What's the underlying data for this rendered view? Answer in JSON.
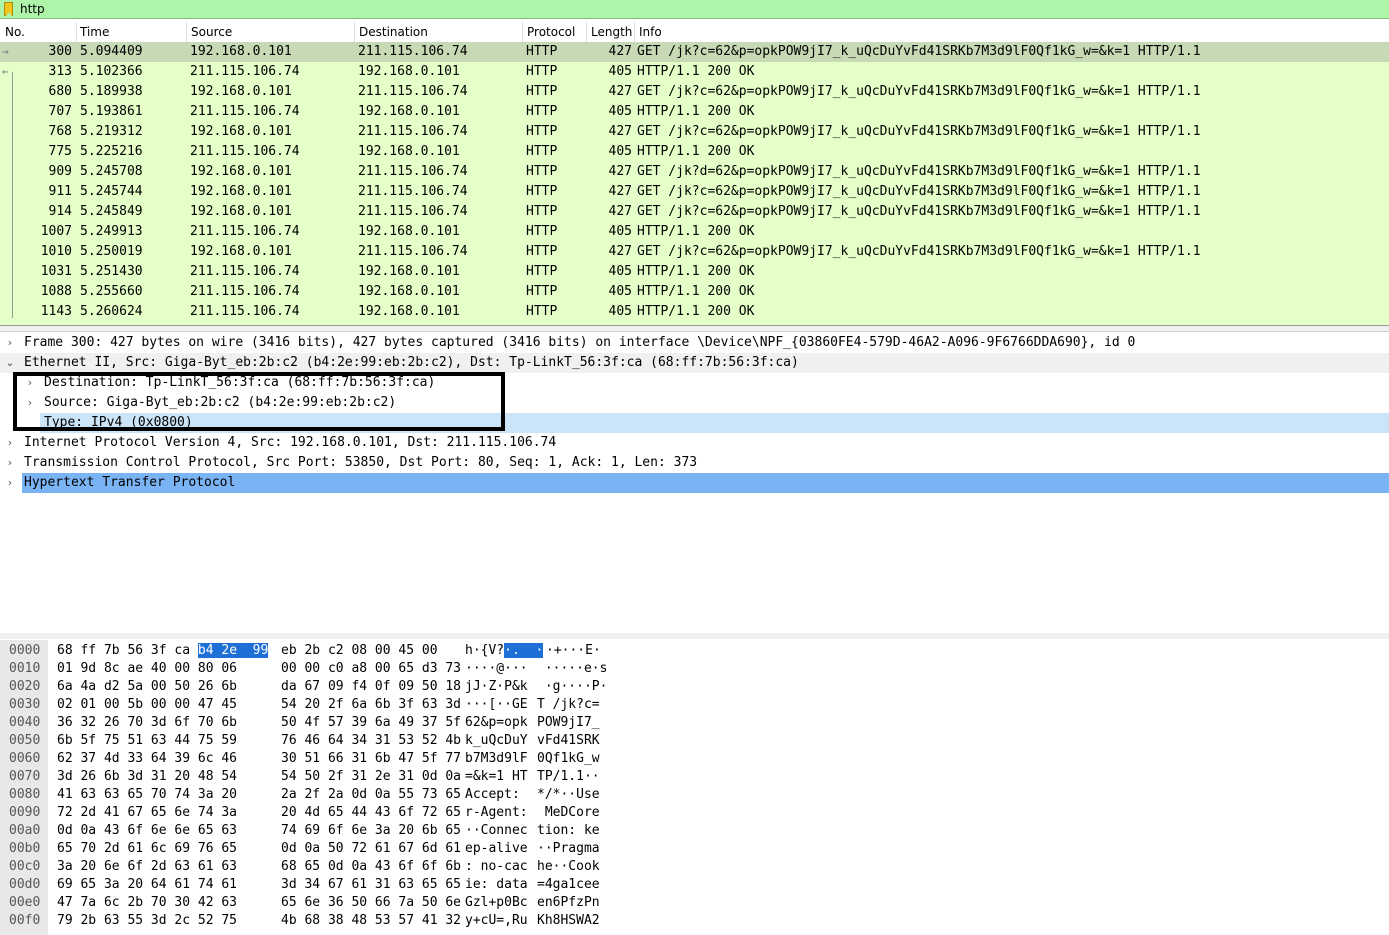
{
  "filter": {
    "value": "http"
  },
  "packet_list": {
    "headers": [
      "No.",
      "Time",
      "Source",
      "Destination",
      "Protocol",
      "Length",
      "Info"
    ],
    "rows": [
      {
        "no": "300",
        "time": "5.094409",
        "src": "192.168.0.101",
        "dst": "211.115.106.74",
        "proto": "HTTP",
        "len": "427",
        "info": "GET /jk?c=62&p=opkPOW9jI7_k_uQcDuYvFd41SRKb7M3d9lF0Qf1kG_w=&k=1 HTTP/1.1"
      },
      {
        "no": "313",
        "time": "5.102366",
        "src": "211.115.106.74",
        "dst": "192.168.0.101",
        "proto": "HTTP",
        "len": "405",
        "info": "HTTP/1.1 200 OK"
      },
      {
        "no": "680",
        "time": "5.189938",
        "src": "192.168.0.101",
        "dst": "211.115.106.74",
        "proto": "HTTP",
        "len": "427",
        "info": "GET /jk?c=62&p=opkPOW9jI7_k_uQcDuYvFd41SRKb7M3d9lF0Qf1kG_w=&k=1 HTTP/1.1"
      },
      {
        "no": "707",
        "time": "5.193861",
        "src": "211.115.106.74",
        "dst": "192.168.0.101",
        "proto": "HTTP",
        "len": "405",
        "info": "HTTP/1.1 200 OK"
      },
      {
        "no": "768",
        "time": "5.219312",
        "src": "192.168.0.101",
        "dst": "211.115.106.74",
        "proto": "HTTP",
        "len": "427",
        "info": "GET /jk?c=62&p=opkPOW9jI7_k_uQcDuYvFd41SRKb7M3d9lF0Qf1kG_w=&k=1 HTTP/1.1"
      },
      {
        "no": "775",
        "time": "5.225216",
        "src": "211.115.106.74",
        "dst": "192.168.0.101",
        "proto": "HTTP",
        "len": "405",
        "info": "HTTP/1.1 200 OK"
      },
      {
        "no": "909",
        "time": "5.245708",
        "src": "192.168.0.101",
        "dst": "211.115.106.74",
        "proto": "HTTP",
        "len": "427",
        "info": "GET /jk?d=62&p=opkPOW9jI7_k_uQcDuYvFd41SRKb7M3d9lF0Qf1kG_w=&k=1 HTTP/1.1"
      },
      {
        "no": "911",
        "time": "5.245744",
        "src": "192.168.0.101",
        "dst": "211.115.106.74",
        "proto": "HTTP",
        "len": "427",
        "info": "GET /jk?c=62&p=opkPOW9jI7_k_uQcDuYvFd41SRKb7M3d9lF0Qf1kG_w=&k=1 HTTP/1.1"
      },
      {
        "no": "914",
        "time": "5.245849",
        "src": "192.168.0.101",
        "dst": "211.115.106.74",
        "proto": "HTTP",
        "len": "427",
        "info": "GET /jk?c=62&p=opkPOW9jI7_k_uQcDuYvFd41SRKb7M3d9lF0Qf1kG_w=&k=1 HTTP/1.1"
      },
      {
        "no": "1007",
        "time": "5.249913",
        "src": "211.115.106.74",
        "dst": "192.168.0.101",
        "proto": "HTTP",
        "len": "405",
        "info": "HTTP/1.1 200 OK"
      },
      {
        "no": "1010",
        "time": "5.250019",
        "src": "192.168.0.101",
        "dst": "211.115.106.74",
        "proto": "HTTP",
        "len": "427",
        "info": "GET /jk?c=62&p=opkPOW9jI7_k_uQcDuYvFd41SRKb7M3d9lF0Qf1kG_w=&k=1 HTTP/1.1"
      },
      {
        "no": "1031",
        "time": "5.251430",
        "src": "211.115.106.74",
        "dst": "192.168.0.101",
        "proto": "HTTP",
        "len": "405",
        "info": "HTTP/1.1 200 OK"
      },
      {
        "no": "1088",
        "time": "5.255660",
        "src": "211.115.106.74",
        "dst": "192.168.0.101",
        "proto": "HTTP",
        "len": "405",
        "info": "HTTP/1.1 200 OK"
      },
      {
        "no": "1143",
        "time": "5.260624",
        "src": "211.115.106.74",
        "dst": "192.168.0.101",
        "proto": "HTTP",
        "len": "405",
        "info": "HTTP/1.1 200 OK"
      }
    ]
  },
  "details": [
    {
      "arrow": "›",
      "text": "Frame 300: 427 bytes on wire (3416 bits), 427 bytes captured (3416 bits) on interface \\Device\\NPF_{03860FE4-579D-46A2-A096-9F6766DDA690}, id 0"
    },
    {
      "arrow": "⌄",
      "text": "Ethernet II, Src: Giga-Byt_eb:2b:c2 (b4:2e:99:eb:2b:c2), Dst: Tp-LinkT_56:3f:ca (68:ff:7b:56:3f:ca)"
    },
    {
      "arrow": "›",
      "text": "Destination: Tp-LinkT_56:3f:ca (68:ff:7b:56:3f:ca)"
    },
    {
      "arrow": "›",
      "text": "Source: Giga-Byt_eb:2b:c2 (b4:2e:99:eb:2b:c2)"
    },
    {
      "arrow": "",
      "text": "Type: IPv4 (0x0800)"
    },
    {
      "arrow": "›",
      "text": "Internet Protocol Version 4, Src: 192.168.0.101, Dst: 211.115.106.74"
    },
    {
      "arrow": "›",
      "text": "Transmission Control Protocol, Src Port: 53850, Dst Port: 80, Seq: 1, Ack: 1, Len: 373"
    },
    {
      "arrow": "›",
      "text": "Hypertext Transfer Protocol"
    }
  ],
  "bytes": [
    {
      "off": "0000",
      "h1": "68 ff 7b 56 3f ca ",
      "h1hl": "b4 2e  99",
      "h2": "eb 2b c2 08 00 45 00",
      "a1": "h·{V?",
      "a1hl": "·.  ·",
      "a2": "·+···E·"
    },
    {
      "off": "0010",
      "h1": "01 9d 8c ae 40 00 80 06",
      "h1hl": "",
      "h2": "00 00 c0 a8 00 65 d3 73",
      "a1": "····@···",
      "a1hl": "",
      "a2": " ·····e·s"
    },
    {
      "off": "0020",
      "h1": "6a 4a d2 5a 00 50 26 6b",
      "h1hl": "",
      "h2": "da 67 09 f4 0f 09 50 18",
      "a1": "jJ·Z·P&k",
      "a1hl": "",
      "a2": " ·g····P·"
    },
    {
      "off": "0030",
      "h1": "02 01 00 5b 00 00 47 45",
      "h1hl": "",
      "h2": "54 20 2f 6a 6b 3f 63 3d",
      "a1": "···[··GE",
      "a1hl": "",
      "a2": "T /jk?c="
    },
    {
      "off": "0040",
      "h1": "36 32 26 70 3d 6f 70 6b",
      "h1hl": "",
      "h2": "50 4f 57 39 6a 49 37 5f",
      "a1": "62&p=opk",
      "a1hl": "",
      "a2": "POW9jI7_"
    },
    {
      "off": "0050",
      "h1": "6b 5f 75 51 63 44 75 59",
      "h1hl": "",
      "h2": "76 46 64 34 31 53 52 4b",
      "a1": "k_uQcDuY",
      "a1hl": "",
      "a2": "vFd41SRK"
    },
    {
      "off": "0060",
      "h1": "62 37 4d 33 64 39 6c 46",
      "h1hl": "",
      "h2": "30 51 66 31 6b 47 5f 77",
      "a1": "b7M3d9lF",
      "a1hl": "",
      "a2": "0Qf1kG_w"
    },
    {
      "off": "0070",
      "h1": "3d 26 6b 3d 31 20 48 54",
      "h1hl": "",
      "h2": "54 50 2f 31 2e 31 0d 0a",
      "a1": "=&k=1 HT",
      "a1hl": "",
      "a2": "TP/1.1··"
    },
    {
      "off": "0080",
      "h1": "41 63 63 65 70 74 3a 20",
      "h1hl": "",
      "h2": "2a 2f 2a 0d 0a 55 73 65",
      "a1": "Accept: ",
      "a1hl": "",
      "a2": "*/*··Use"
    },
    {
      "off": "0090",
      "h1": "72 2d 41 67 65 6e 74 3a",
      "h1hl": "",
      "h2": "20 4d 65 44 43 6f 72 65",
      "a1": "r-Agent:",
      "a1hl": "",
      "a2": " MeDCore"
    },
    {
      "off": "00a0",
      "h1": "0d 0a 43 6f 6e 6e 65 63",
      "h1hl": "",
      "h2": "74 69 6f 6e 3a 20 6b 65",
      "a1": "··Connec",
      "a1hl": "",
      "a2": "tion: ke"
    },
    {
      "off": "00b0",
      "h1": "65 70 2d 61 6c 69 76 65",
      "h1hl": "",
      "h2": "0d 0a 50 72 61 67 6d 61",
      "a1": "ep-alive",
      "a1hl": "",
      "a2": "··Pragma"
    },
    {
      "off": "00c0",
      "h1": "3a 20 6e 6f 2d 63 61 63",
      "h1hl": "",
      "h2": "68 65 0d 0a 43 6f 6f 6b",
      "a1": ": no-cac",
      "a1hl": "",
      "a2": "he··Cook"
    },
    {
      "off": "00d0",
      "h1": "69 65 3a 20 64 61 74 61",
      "h1hl": "",
      "h2": "3d 34 67 61 31 63 65 65",
      "a1": "ie: data",
      "a1hl": "",
      "a2": "=4ga1cee"
    },
    {
      "off": "00e0",
      "h1": "47 7a 6c 2b 70 30 42 63",
      "h1hl": "",
      "h2": "65 6e 36 50 66 7a 50 6e",
      "a1": "Gzl+p0Bc",
      "a1hl": "",
      "a2": "en6PfzPn"
    },
    {
      "off": "00f0",
      "h1": "79 2b 63 55 3d 2c 52 75",
      "h1hl": "",
      "h2": "4b 68 38 48 53 57 41 32",
      "a1": "y+cU=,Ru",
      "a1hl": "",
      "a2": "Kh8HSWA2"
    }
  ]
}
